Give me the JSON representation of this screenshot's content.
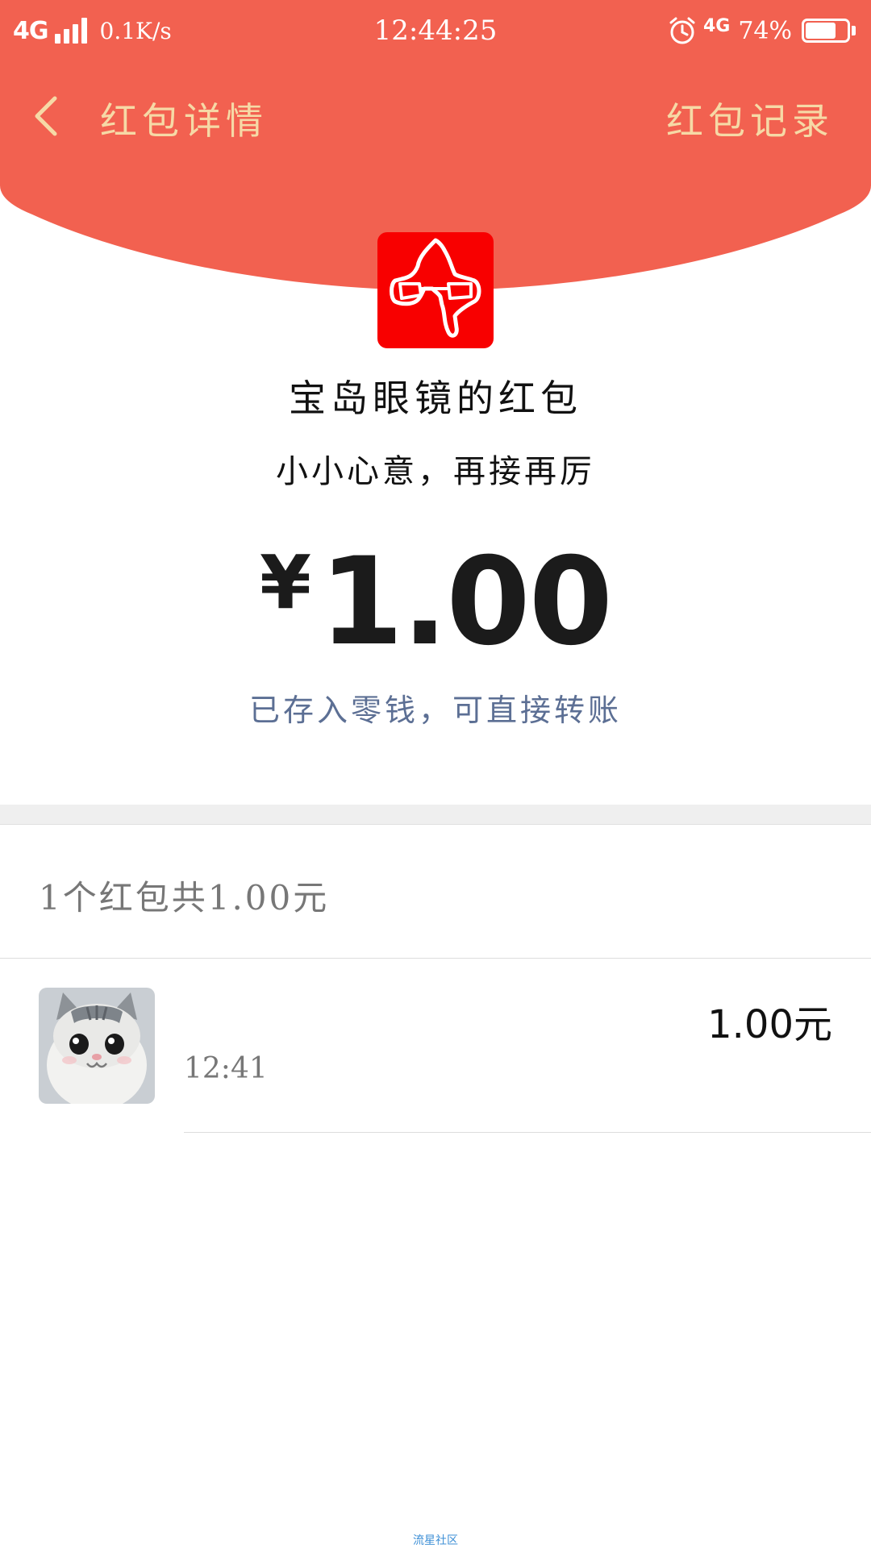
{
  "colors": {
    "header_bg": "#f26150",
    "header_text": "#f6d9a6",
    "logo_bg": "#f80000",
    "note_text": "#5c6f94"
  },
  "status_bar": {
    "network": "4G",
    "speed": "0.1K/s",
    "time": "12:44:25",
    "network_right": "4G",
    "battery": "74%",
    "battery_level": 0.74,
    "icons": [
      "signal-icon",
      "alarm-icon",
      "battery-icon"
    ]
  },
  "header": {
    "back_icon": "chevron-left-icon",
    "title": "红包详情",
    "records_link": "红包记录"
  },
  "red_packet": {
    "sender": "宝岛眼镜的红包",
    "greeting": "小小心意，再接再厉",
    "currency": "¥",
    "amount": "1.00",
    "note": "已存入零钱，可直接转账"
  },
  "summary": "1个红包共1.00元",
  "records": [
    {
      "avatar_icon": "cat-avatar",
      "time": "12:41",
      "amount": "1.00元"
    }
  ],
  "watermark": "流星社区"
}
